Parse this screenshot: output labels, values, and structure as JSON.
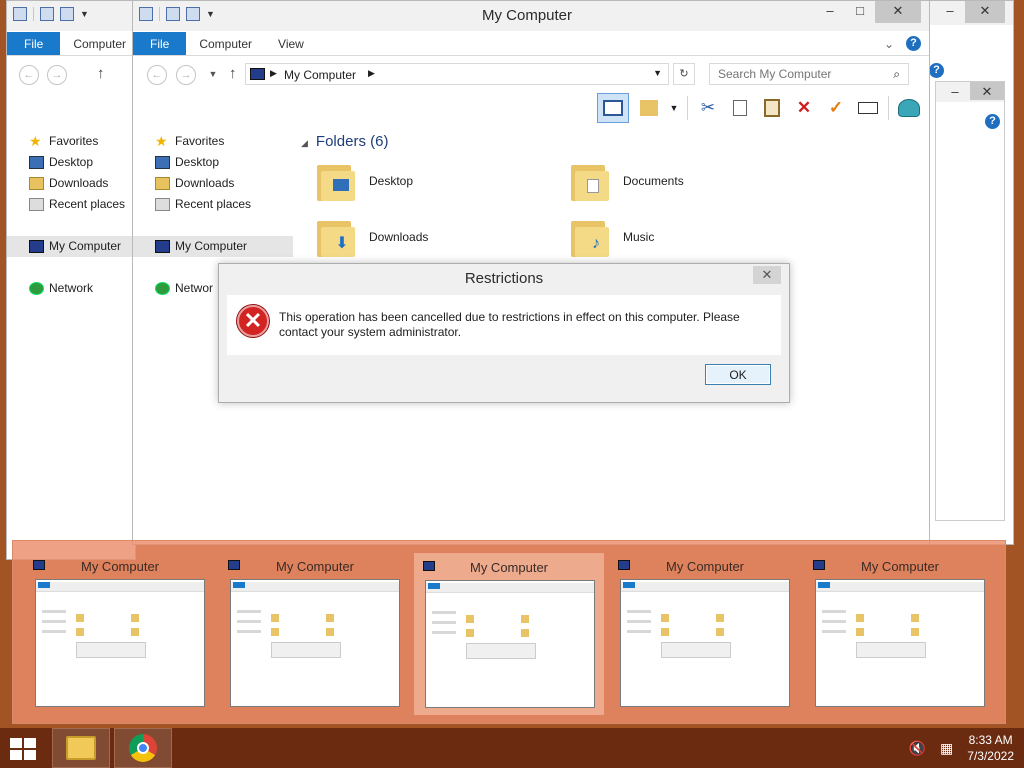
{
  "main_window": {
    "title": "My Computer",
    "tabs": [
      "File",
      "Computer",
      "View"
    ],
    "breadcrumb": "My Computer",
    "search_placeholder": "Search My Computer",
    "folders_heading": "Folders (6)",
    "folders": [
      {
        "name": "Desktop",
        "icon": "desktop-folder-icon"
      },
      {
        "name": "Documents",
        "icon": "documents-folder-icon"
      },
      {
        "name": "Downloads",
        "icon": "downloads-folder-icon"
      },
      {
        "name": "Music",
        "icon": "music-folder-icon"
      }
    ]
  },
  "back_window": {
    "tabs": [
      "File",
      "Computer"
    ]
  },
  "nav_pane": {
    "favorites": "Favorites",
    "desktop": "Desktop",
    "downloads": "Downloads",
    "recent_places": "Recent places",
    "my_computer": "My Computer",
    "network": "Network",
    "network_cut": "Networ"
  },
  "window_controls": {
    "minimize": "–",
    "maximize": "□",
    "close": "✕"
  },
  "dialog": {
    "title": "Restrictions",
    "message": "This operation has been cancelled due to restrictions in effect on this computer. Please contact your system administrator.",
    "ok_label": "OK",
    "close_glyph": "✕"
  },
  "switcher": {
    "thumbnails": [
      {
        "title": "My Computer"
      },
      {
        "title": "My Computer"
      },
      {
        "title": "My Computer"
      },
      {
        "title": "My Computer"
      },
      {
        "title": "My Computer"
      }
    ]
  },
  "taskbar": {
    "time": "8:33 AM",
    "date": "7/3/2022"
  }
}
